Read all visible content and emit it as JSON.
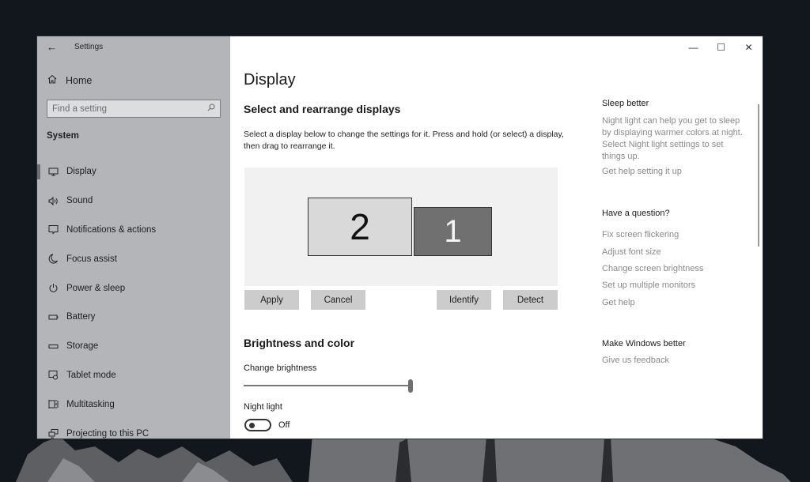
{
  "window": {
    "app_title": "Settings",
    "controls": {
      "minimize": "—",
      "maximize": "☐",
      "close": "✕"
    }
  },
  "sidebar": {
    "back_icon": "←",
    "home": {
      "icon": "home-icon",
      "label": "Home"
    },
    "search": {
      "placeholder": "Find a setting",
      "value": "",
      "icon": "search-icon"
    },
    "section": "System",
    "items": [
      {
        "label": "Display",
        "icon": "monitor-icon",
        "active": true
      },
      {
        "label": "Sound",
        "icon": "speaker-icon",
        "active": false
      },
      {
        "label": "Notifications & actions",
        "icon": "notification-icon",
        "active": false
      },
      {
        "label": "Focus assist",
        "icon": "moon-icon",
        "active": false
      },
      {
        "label": "Power & sleep",
        "icon": "power-icon",
        "active": false
      },
      {
        "label": "Battery",
        "icon": "battery-icon",
        "active": false
      },
      {
        "label": "Storage",
        "icon": "storage-icon",
        "active": false
      },
      {
        "label": "Tablet mode",
        "icon": "tablet-mode-icon",
        "active": false
      },
      {
        "label": "Multitasking",
        "icon": "multitasking-icon",
        "active": false
      },
      {
        "label": "Projecting to this PC",
        "icon": "projecting-icon",
        "active": false
      }
    ]
  },
  "main": {
    "title": "Display",
    "arrange": {
      "heading": "Select and rearrange displays",
      "description": "Select a display below to change the settings for it. Press and hold (or select) a display, then drag to rearrange it.",
      "monitors": [
        {
          "number": "2",
          "selected": false
        },
        {
          "number": "1",
          "selected": true
        }
      ],
      "buttons": {
        "apply": "Apply",
        "cancel": "Cancel",
        "identify": "Identify",
        "detect": "Detect"
      }
    },
    "brightness": {
      "heading": "Brightness and color",
      "change_label": "Change brightness",
      "brightness_percent": 100,
      "night_light_label": "Night light",
      "night_light_state": "Off"
    }
  },
  "aside": {
    "sleep": {
      "heading": "Sleep better",
      "text": "Night light can help you get to sleep by displaying warmer colors at night. Select Night light settings to set things up.",
      "link": "Get help setting it up"
    },
    "question": {
      "heading": "Have a question?",
      "links": [
        "Fix screen flickering",
        "Adjust font size",
        "Change screen brightness",
        "Set up multiple monitors",
        "Get help"
      ]
    },
    "feedback": {
      "heading": "Make Windows better",
      "link": "Give us feedback"
    }
  }
}
